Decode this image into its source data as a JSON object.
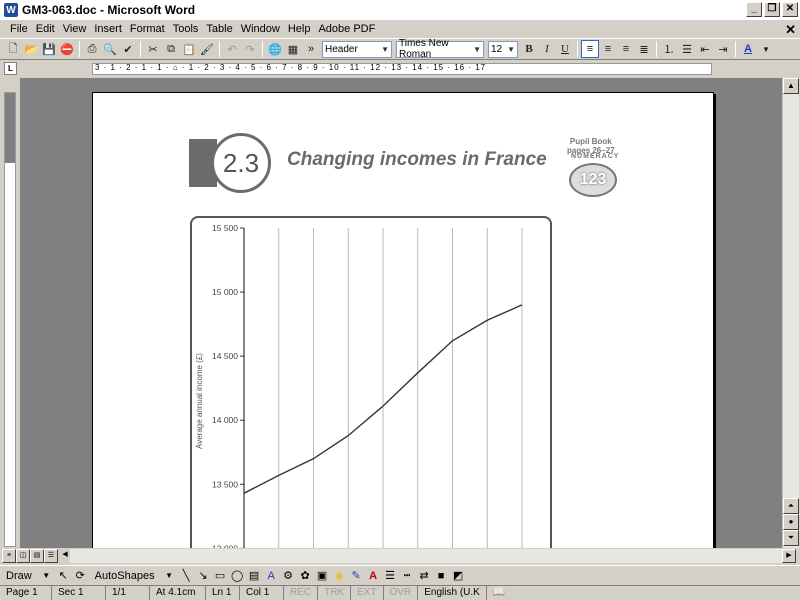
{
  "window": {
    "title": "GM3-063.doc - Microsoft Word",
    "app_icon": "W"
  },
  "menus": [
    "File",
    "Edit",
    "View",
    "Insert",
    "Format",
    "Tools",
    "Table",
    "Window",
    "Help",
    "Adobe PDF"
  ],
  "toolbar": {
    "style": "Header",
    "font": "Times New Roman",
    "size": "12"
  },
  "ruler": {
    "corner": "L",
    "marks": "3 · 1 · 2 · 1 · 1 · ⌂ · 1 · 2 · 3 · 4 · 5 · 6 · 7 · 8 · 9 · 10 · 11 · 12 · 13 · 14 · 15 · 16 · 17"
  },
  "page": {
    "badge": "2.3",
    "heading": "Changing incomes in France",
    "pupil_book": [
      "Pupil Book",
      "pages 26–27"
    ],
    "numeracy_top": "NUMERACY",
    "numeracy_logo": "123"
  },
  "chart_data": {
    "type": "line",
    "ylabel": "Average annual income (£)",
    "yticks": [
      "15 500",
      "15 000",
      "14 500",
      "14 000",
      "13 500",
      "13 000"
    ],
    "ytick_values": [
      15500,
      15000,
      14500,
      14000,
      13500,
      13000
    ],
    "ylim": [
      12800,
      15500
    ],
    "x_gridlines": 9,
    "series": [
      {
        "values": [
          13430,
          13570,
          13700,
          13880,
          14110,
          14370,
          14620,
          14780,
          14900
        ]
      }
    ],
    "grid": true
  },
  "drawbar": {
    "draw_label": "Draw",
    "autoshapes_label": "AutoShapes"
  },
  "status": {
    "page": "Page 1",
    "sec": "Sec 1",
    "pages": "1/1",
    "at": "At 4.1cm",
    "ln": "Ln 1",
    "col": "Col 1",
    "rec": "REC",
    "trk": "TRK",
    "ext": "EXT",
    "ovr": "OVR",
    "lang": "English (U.K"
  }
}
